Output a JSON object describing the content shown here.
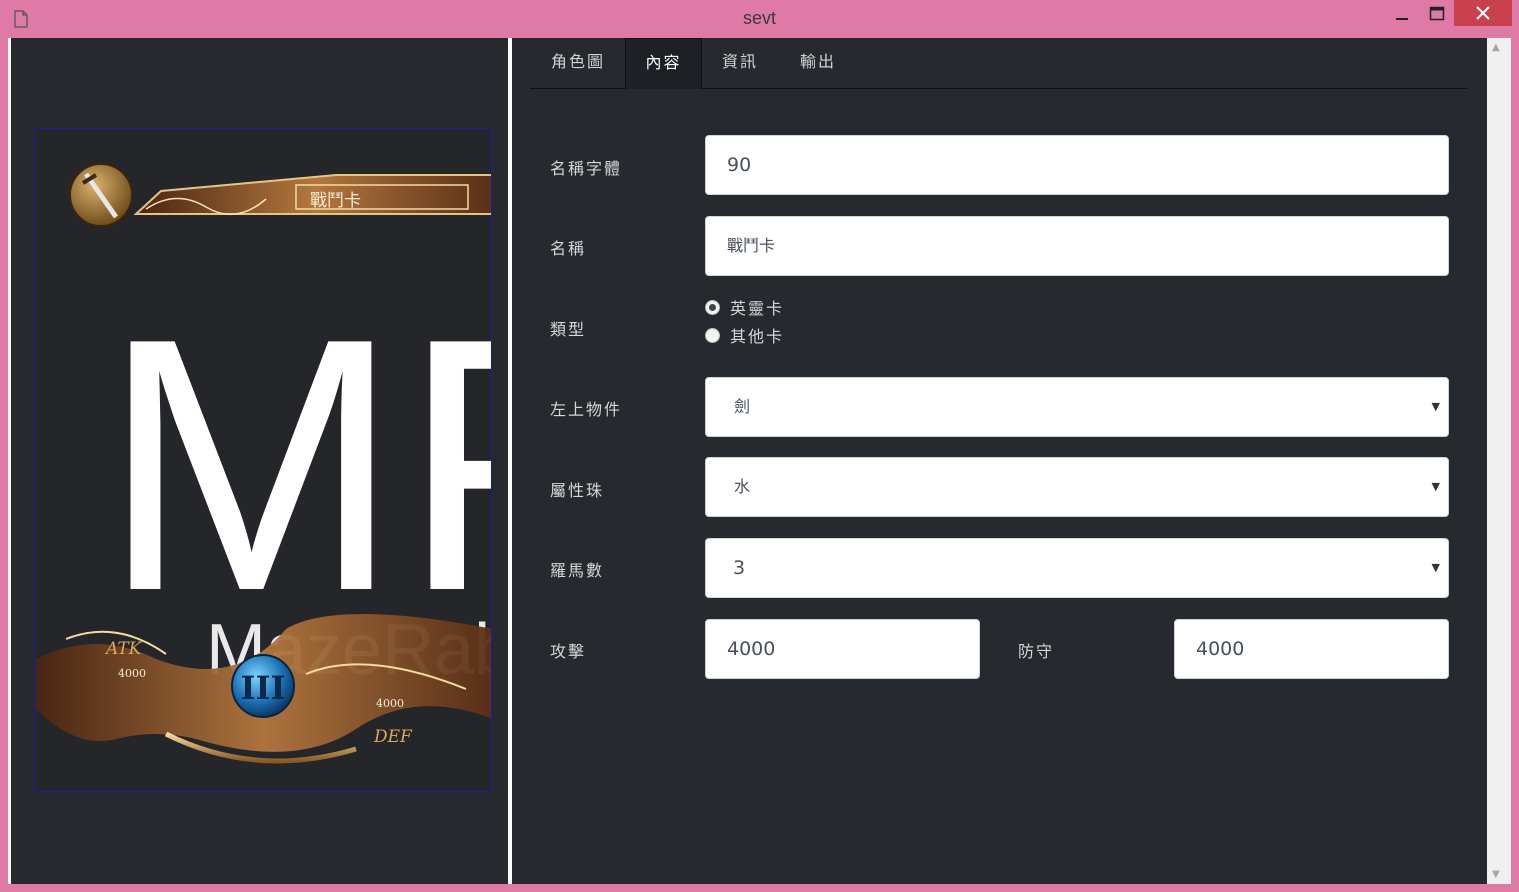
{
  "window": {
    "title": "sevt"
  },
  "tabs": [
    {
      "label": "角色圖"
    },
    {
      "label": "內容"
    },
    {
      "label": "資訊"
    },
    {
      "label": "輸出"
    }
  ],
  "active_tab": "內容",
  "card_preview": {
    "title": "戰鬥卡",
    "watermark_big": "MF",
    "watermark_small": "MazeRab",
    "atk_label": "ATK",
    "atk_value": "4000",
    "def_label": "DEF",
    "def_value": "4000",
    "roman": "III",
    "icon": "sword-icon"
  },
  "form": {
    "name_font": {
      "label": "名稱字體",
      "value": "90"
    },
    "name": {
      "label": "名稱",
      "value": "戰鬥卡"
    },
    "type": {
      "label": "類型",
      "options": [
        {
          "label": "英靈卡",
          "checked": true
        },
        {
          "label": "其他卡",
          "checked": false
        }
      ]
    },
    "top_left_item": {
      "label": "左上物件",
      "value": "劍"
    },
    "attribute_orb": {
      "label": "屬性珠",
      "value": "水"
    },
    "roman_number": {
      "label": "羅馬數",
      "value": "3"
    },
    "attack": {
      "label": "攻擊",
      "value": "4000"
    },
    "defense": {
      "label": "防守",
      "value": "4000"
    }
  },
  "colors": {
    "titlebar": "#df7aa6",
    "background": "#262a2f",
    "close_button": "#c8414d",
    "card_border": "#1c1ca8"
  }
}
